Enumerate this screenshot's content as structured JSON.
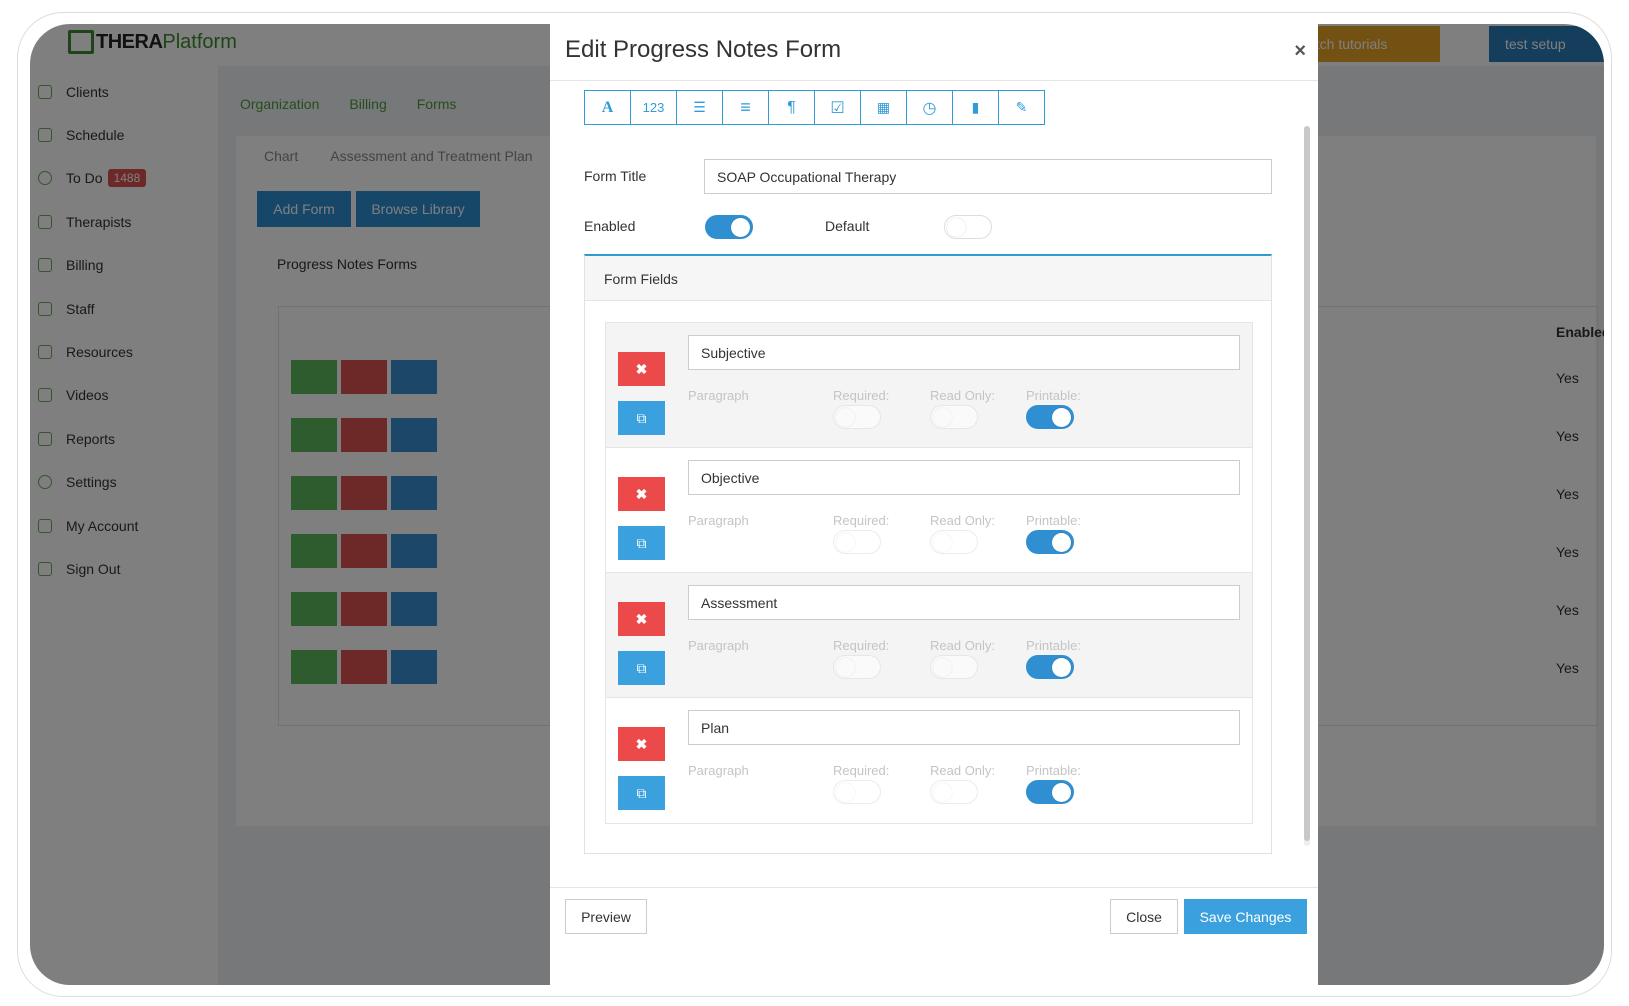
{
  "app": {
    "logo_part1": "THERA",
    "logo_part2": "Platform",
    "header_buttons": {
      "tutorials": "atch tutorials",
      "setup": "test setup"
    }
  },
  "sidebar": {
    "items": [
      {
        "label": "Clients"
      },
      {
        "label": "Schedule"
      },
      {
        "label": "To Do",
        "badge": "1488"
      },
      {
        "label": "Therapists"
      },
      {
        "label": "Billing"
      },
      {
        "label": "Staff"
      },
      {
        "label": "Resources"
      },
      {
        "label": "Videos"
      },
      {
        "label": "Reports"
      },
      {
        "label": "Settings"
      },
      {
        "label": "My Account"
      },
      {
        "label": "Sign Out"
      }
    ]
  },
  "background": {
    "top_tabs": [
      "Organization",
      "Billing",
      "Forms"
    ],
    "sub_tabs": [
      "Chart",
      "Assessment and Treatment Plan"
    ],
    "add_form": "Add Form",
    "browse_library": "Browse Library",
    "panel_title": "Progress Notes Forms",
    "enabled_header": "Enabled",
    "rows_enabled": [
      "Yes",
      "Yes",
      "Yes",
      "Yes",
      "Yes",
      "Yes"
    ]
  },
  "modal": {
    "title": "Edit Progress Notes Form",
    "toolbar": [
      {
        "icon": "text-icon",
        "glyph": "A"
      },
      {
        "icon": "number-icon",
        "glyph": "123"
      },
      {
        "icon": "bulleted-list-icon",
        "glyph": "☰"
      },
      {
        "icon": "lines-icon",
        "glyph": "≡"
      },
      {
        "icon": "paragraph-icon",
        "glyph": "¶"
      },
      {
        "icon": "checkbox-icon",
        "glyph": "☑"
      },
      {
        "icon": "calendar-icon",
        "glyph": "▦"
      },
      {
        "icon": "clock-icon",
        "glyph": "◷"
      },
      {
        "icon": "bookmark-icon",
        "glyph": "▮"
      },
      {
        "icon": "edit-icon",
        "glyph": "✎"
      }
    ],
    "form_title_label": "Form Title",
    "form_title_value": "SOAP Occupational Therapy",
    "enabled_label": "Enabled",
    "enabled_on": true,
    "default_label": "Default",
    "default_on": false,
    "form_fields_label": "Form Fields",
    "fields": [
      {
        "name": "Subjective",
        "type": "Paragraph",
        "required_label": "Required:",
        "readonly_label": "Read Only:",
        "printable_label": "Printable:",
        "required": false,
        "read_only": false,
        "printable": true
      },
      {
        "name": "Objective",
        "type": "Paragraph",
        "required_label": "Required:",
        "readonly_label": "Read Only:",
        "printable_label": "Printable:",
        "required": false,
        "read_only": false,
        "printable": true
      },
      {
        "name": "Assessment",
        "type": "Paragraph",
        "required_label": "Required:",
        "readonly_label": "Read Only:",
        "printable_label": "Printable:",
        "required": false,
        "read_only": false,
        "printable": true
      },
      {
        "name": "Plan",
        "type": "Paragraph",
        "required_label": "Required:",
        "readonly_label": "Read Only:",
        "printable_label": "Printable:",
        "required": false,
        "read_only": false,
        "printable": true
      }
    ],
    "preview_label": "Preview",
    "close_label": "Close",
    "save_label": "Save Changes",
    "close_glyph": "×",
    "delete_glyph": "✖",
    "copy_glyph": "⧉"
  },
  "colors": {
    "accent": "#2f8fd1",
    "danger": "#ec4a4a",
    "brand_green": "#3d8b2f"
  }
}
